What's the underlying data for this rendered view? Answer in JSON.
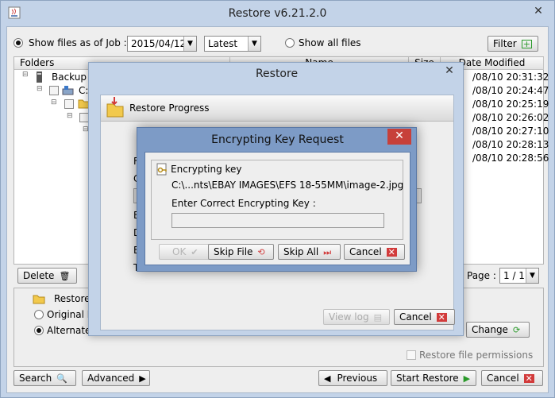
{
  "window": {
    "title": "Restore v6.21.2.0",
    "close_glyph": "✕"
  },
  "top_bar": {
    "show_as_of_job_label": "Show files as of Job :",
    "job_date": "2015/04/12",
    "version_value": "Latest",
    "show_all_label": "Show all files",
    "filter_label": "Filter"
  },
  "table": {
    "headers": {
      "folders": "Folders",
      "name": "Name",
      "size": "Size",
      "date_modified": "Date Modified"
    },
    "tree_root": "Backup S",
    "tree_drive": "C:",
    "dates": [
      "/08/10 20:31:32",
      "/08/10 20:24:47",
      "/08/10 20:25:19",
      "/08/10 20:26:02",
      "/08/10 20:27:10",
      "/08/10 20:28:13",
      "/08/10 20:28:56"
    ]
  },
  "list_controls": {
    "delete_label": "Delete",
    "page_label": "Page :",
    "page_value": "1 / 1"
  },
  "restore_options": {
    "section_label": "Restore",
    "original_label": "Original lo",
    "alternate_label": "Alternate l",
    "change_label": "Change",
    "permissions_label": "Restore file permissions"
  },
  "bottom_bar": {
    "search_label": "Search",
    "advanced_label": "Advanced",
    "previous_label": "Previous",
    "start_restore_label": "Start Restore",
    "cancel_label": "Cancel"
  },
  "restore_dialog": {
    "title": "Restore",
    "close_glyph": "✕",
    "banner": "Restore Progress",
    "row_letters": [
      "F",
      "C",
      "E",
      "D",
      "E",
      "T"
    ],
    "view_log_label": "View log",
    "cancel_label": "Cancel"
  },
  "encrypt_dialog": {
    "title": "Encrypting Key Request",
    "close_glyph": "✕",
    "group_label": "Encrypting key",
    "file_path": "C:\\...nts\\EBAY IMAGES\\EFS 18-55MM\\image-2.jpg",
    "prompt": "Enter Correct Encrypting Key :",
    "key_value": "",
    "ok_label": "OK",
    "skip_file_label": "Skip File",
    "skip_all_label": "Skip All",
    "cancel_label": "Cancel"
  },
  "colors": {
    "accent_green": "#2a9a2a",
    "accent_red": "#d23b3b",
    "title_bar": "#c3d3e8",
    "dialog_blue": "#7d9bc6"
  }
}
